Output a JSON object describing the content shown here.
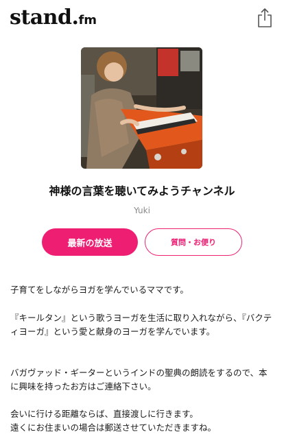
{
  "header": {
    "logo_main": "stand",
    "logo_dot": ".",
    "logo_fm": "fm",
    "share_icon": "share-icon"
  },
  "channel": {
    "title": "神様の言葉を聴いてみようチャンネル",
    "author": "Yuki",
    "cover_image": "photo of a person playing a harmonium"
  },
  "actions": {
    "latest_label": "最新の放送",
    "questions_label": "質問・お便り"
  },
  "description": {
    "p1": "子育てをしながらヨガを学んでいるママです。",
    "p2": "『キールタン』という歌うヨーガを生活に取り入れながら、『バクティヨーガ』という愛と献身のヨーガを学んでいます。",
    "p3": "バガヴァッド・ギーターというインドの聖典の朗読をするので、本に興味を持ったお方はご連絡下さい。",
    "p4a": "会いに行ける距離ならば、直接渡しに行きます。",
    "p4b": "遠くにお住まいの場合は郵送させていただきますね。"
  },
  "colors": {
    "accent": "#ee1f73",
    "text": "#1a1a1a",
    "muted": "#888888"
  }
}
